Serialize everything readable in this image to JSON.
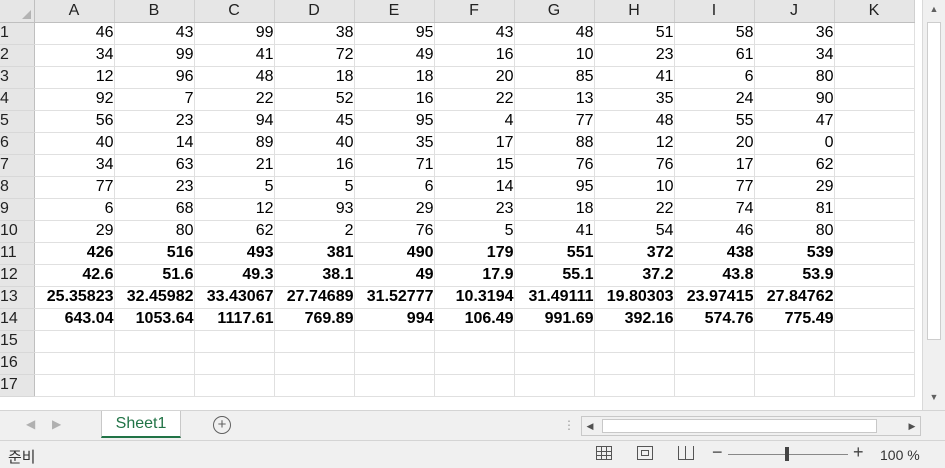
{
  "columns": [
    "A",
    "B",
    "C",
    "D",
    "E",
    "F",
    "G",
    "H",
    "I",
    "J",
    "K"
  ],
  "rows": [
    {
      "n": "1",
      "v": [
        "46",
        "43",
        "99",
        "38",
        "95",
        "43",
        "48",
        "51",
        "58",
        "36"
      ]
    },
    {
      "n": "2",
      "v": [
        "34",
        "99",
        "41",
        "72",
        "49",
        "16",
        "10",
        "23",
        "61",
        "34"
      ]
    },
    {
      "n": "3",
      "v": [
        "12",
        "96",
        "48",
        "18",
        "18",
        "20",
        "85",
        "41",
        "6",
        "80"
      ]
    },
    {
      "n": "4",
      "v": [
        "92",
        "7",
        "22",
        "52",
        "16",
        "22",
        "13",
        "35",
        "24",
        "90"
      ]
    },
    {
      "n": "5",
      "v": [
        "56",
        "23",
        "94",
        "45",
        "95",
        "4",
        "77",
        "48",
        "55",
        "47"
      ]
    },
    {
      "n": "6",
      "v": [
        "40",
        "14",
        "89",
        "40",
        "35",
        "17",
        "88",
        "12",
        "20",
        "0"
      ]
    },
    {
      "n": "7",
      "v": [
        "34",
        "63",
        "21",
        "16",
        "71",
        "15",
        "76",
        "76",
        "17",
        "62"
      ]
    },
    {
      "n": "8",
      "v": [
        "77",
        "23",
        "5",
        "5",
        "6",
        "14",
        "95",
        "10",
        "77",
        "29"
      ]
    },
    {
      "n": "9",
      "v": [
        "6",
        "68",
        "12",
        "93",
        "29",
        "23",
        "18",
        "22",
        "74",
        "81"
      ]
    },
    {
      "n": "10",
      "v": [
        "29",
        "80",
        "62",
        "2",
        "76",
        "5",
        "41",
        "54",
        "46",
        "80"
      ]
    },
    {
      "n": "11",
      "bold": true,
      "v": [
        "426",
        "516",
        "493",
        "381",
        "490",
        "179",
        "551",
        "372",
        "438",
        "539"
      ]
    },
    {
      "n": "12",
      "bold": true,
      "v": [
        "42.6",
        "51.6",
        "49.3",
        "38.1",
        "49",
        "17.9",
        "55.1",
        "37.2",
        "43.8",
        "53.9"
      ]
    },
    {
      "n": "13",
      "bold": true,
      "v": [
        "25.35823",
        "32.45982",
        "33.43067",
        "27.74689",
        "31.52777",
        "10.3194",
        "31.49111",
        "19.80303",
        "23.97415",
        "27.84762"
      ]
    },
    {
      "n": "14",
      "bold": true,
      "v": [
        "643.04",
        "1053.64",
        "1117.61",
        "769.89",
        "994",
        "106.49",
        "991.69",
        "392.16",
        "574.76",
        "775.49"
      ]
    },
    {
      "n": "15",
      "v": []
    },
    {
      "n": "16",
      "v": []
    },
    {
      "n": "17",
      "v": []
    }
  ],
  "sheet_tab": "Sheet1",
  "add_sheet_icon": "plus-circle-icon",
  "status": "준비",
  "zoom_level": "100 %",
  "colors": {
    "accent": "#217346",
    "header_bg": "#e6e6e6",
    "gridline": "#e0e0e0"
  }
}
